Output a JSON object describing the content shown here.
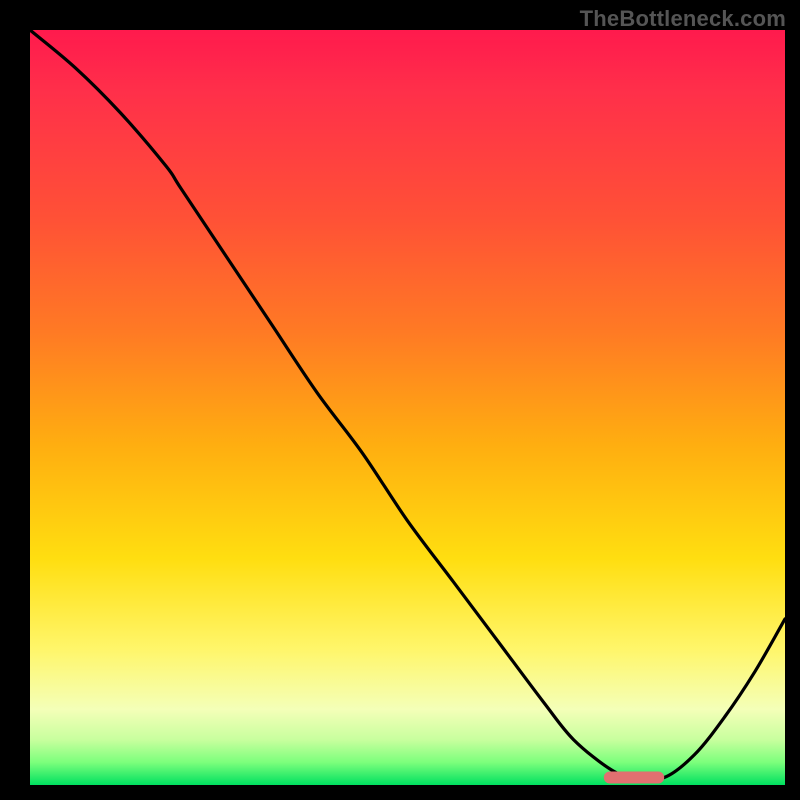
{
  "watermark": "TheBottleneck.com",
  "chart_data": {
    "type": "line",
    "title": "",
    "xlabel": "",
    "ylabel": "",
    "xlim": [
      0,
      100
    ],
    "ylim": [
      0,
      100
    ],
    "grid": false,
    "series": [
      {
        "name": "bottleneck-curve",
        "x": [
          0,
          6,
          12,
          18,
          20,
          26,
          32,
          38,
          44,
          50,
          56,
          62,
          68,
          72,
          77,
          80,
          84,
          88,
          92,
          96,
          100
        ],
        "y": [
          100,
          95,
          89,
          82,
          79,
          70,
          61,
          52,
          44,
          35,
          27,
          19,
          11,
          6,
          2,
          1,
          1,
          4,
          9,
          15,
          22
        ]
      }
    ],
    "annotations": [
      {
        "name": "optimum-marker",
        "x_center": 80,
        "y": 1,
        "width": 8
      }
    ],
    "background_gradient": {
      "orientation": "vertical",
      "stops": [
        {
          "pct": 0,
          "color": "#ff1a4d"
        },
        {
          "pct": 25,
          "color": "#ff5136"
        },
        {
          "pct": 55,
          "color": "#ffae10"
        },
        {
          "pct": 82,
          "color": "#fff66a"
        },
        {
          "pct": 97,
          "color": "#7cff7c"
        },
        {
          "pct": 100,
          "color": "#00e060"
        }
      ]
    }
  }
}
